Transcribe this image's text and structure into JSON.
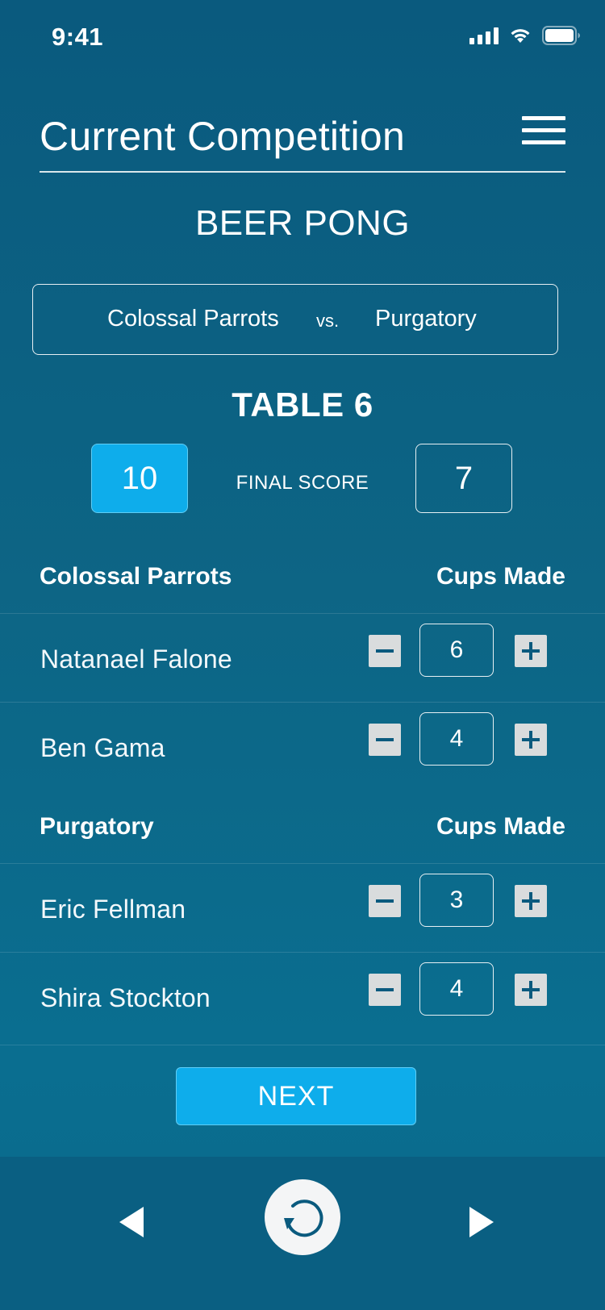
{
  "status_bar": {
    "time": "9:41"
  },
  "header": {
    "title": "Current Competition"
  },
  "game": {
    "title": "BEER PONG"
  },
  "matchup": {
    "team1": "Colossal Parrots",
    "vs": "vs.",
    "team2": "Purgatory"
  },
  "table": {
    "title": "TABLE 6"
  },
  "scores": {
    "team1": "10",
    "label": "FINAL SCORE",
    "team2": "7"
  },
  "sections": [
    {
      "team": "Colossal Parrots",
      "cups_header": "Cups Made",
      "players": [
        {
          "name": "Natanael Falone",
          "cups": "6"
        },
        {
          "name": "Ben Gama",
          "cups": "4"
        }
      ]
    },
    {
      "team": "Purgatory",
      "cups_header": "Cups Made",
      "players": [
        {
          "name": "Eric Fellman",
          "cups": "3"
        },
        {
          "name": "Shira Stockton",
          "cups": "4"
        }
      ]
    }
  ],
  "actions": {
    "next_label": "NEXT"
  },
  "icons": {
    "menu": "menu-icon",
    "prev": "triangle-left-icon",
    "next": "triangle-right-icon",
    "refresh": "refresh-icon",
    "signal": "signal-icon",
    "wifi": "wifi-icon",
    "battery": "battery-icon"
  },
  "colors": {
    "background": "#0a5a7e",
    "accent": "#0eadeb",
    "stepper": "#d9dcdd"
  }
}
